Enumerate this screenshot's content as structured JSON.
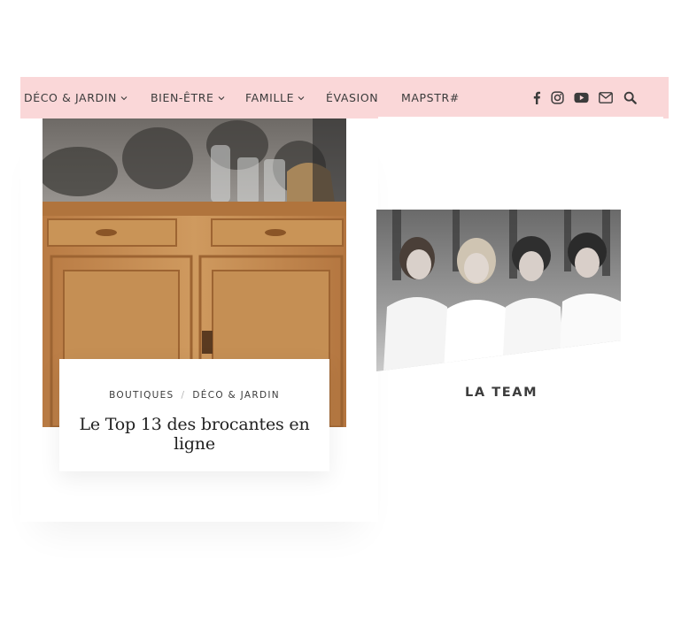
{
  "nav": {
    "items": [
      {
        "label": "DÉCO & JARDIN",
        "has_dropdown": true
      },
      {
        "label": "BIEN-ÊTRE",
        "has_dropdown": true
      },
      {
        "label": "FAMILLE",
        "has_dropdown": true
      },
      {
        "label": "ÉVASION",
        "has_dropdown": false
      },
      {
        "label": "MAPSTR#",
        "has_dropdown": false
      }
    ],
    "social_icons": [
      "facebook-icon",
      "instagram-icon",
      "youtube-icon",
      "mail-icon"
    ],
    "search_icon": "search-icon",
    "background_color": "#fad7d8"
  },
  "feature_post": {
    "categories": [
      "BOUTIQUES",
      "DÉCO & JARDIN"
    ],
    "separator": "/",
    "title": "Le Top 13 des brocantes en ligne"
  },
  "team": {
    "label": "LA TEAM",
    "accent_color": "#fad7d8"
  }
}
